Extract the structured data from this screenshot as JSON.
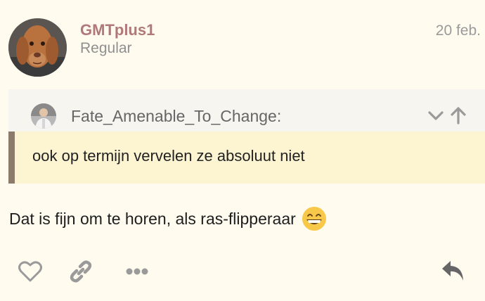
{
  "post": {
    "username": "GMTplus1",
    "user_title": "Regular",
    "date": "20 feb.",
    "quote": {
      "author": "Fate_Amenable_To_Change:",
      "text": "ook op termijn vervelen ze absoluut niet"
    },
    "body": "Dat is fijn om te horen, als ras-flipperaar",
    "emoji": "grinning-face-with-smiling-eyes"
  },
  "actions": [
    "heart-icon",
    "link-icon",
    "more-icon",
    "reply-icon"
  ],
  "colors": {
    "background": "#fffcef",
    "username": "#b07878",
    "quote_border": "#8c7a6a",
    "quote_background": "#fdf4d2",
    "icon": "#9a9a9a"
  }
}
